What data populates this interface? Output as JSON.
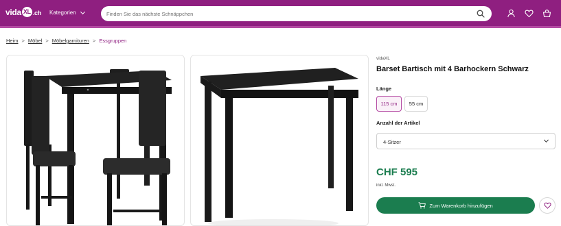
{
  "header": {
    "logo_text": "vida",
    "logo_badge": "XL",
    "logo_tld": ".ch",
    "categories_label": "Kategorien",
    "search_placeholder": "Finden Sie das nächste Schnäppchen",
    "icons": [
      "user-icon",
      "heart-icon",
      "basket-icon"
    ],
    "brand_color": "#8f1f80"
  },
  "breadcrumb": {
    "items": [
      "Heim",
      "Möbel",
      "Möbelgarnituren"
    ],
    "current": "Essgruppen",
    "separator": ">"
  },
  "product": {
    "brand": "vidaXL",
    "title": "Barset Bartisch mit 4 Barhockern Schwarz",
    "length_label": "Länge",
    "length_options": [
      "115 cm",
      "55 cm"
    ],
    "length_selected": "115 cm",
    "quantity_label": "Anzahl der Artikel",
    "quantity_selected": "4-Sitzer",
    "price": "CHF 595",
    "vat_note": "inkl. Mwst.",
    "cart_button": "Zum Warenkorb hinzufügen",
    "price_color": "#1b7d4f"
  }
}
